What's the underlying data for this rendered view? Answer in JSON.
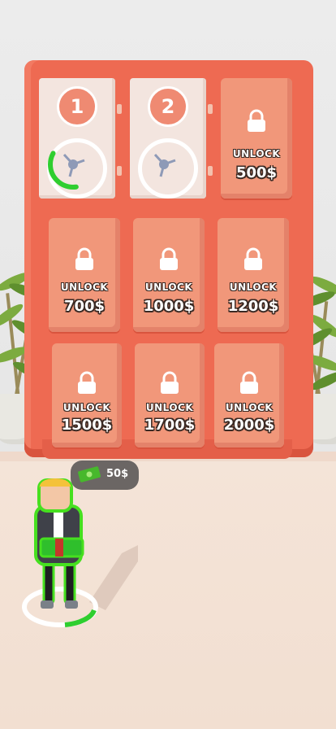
{
  "doors": [
    {
      "id": "door-1",
      "state": "open",
      "number": "1",
      "progress": 0.35
    },
    {
      "id": "door-2",
      "state": "open",
      "number": "2",
      "progress": 0
    },
    {
      "id": "door-3",
      "state": "locked",
      "label": "UNLOCK",
      "price": "500$"
    },
    {
      "id": "door-4",
      "state": "locked",
      "label": "UNLOCK",
      "price": "700$"
    },
    {
      "id": "door-5",
      "state": "locked",
      "label": "UNLOCK",
      "price": "1000$"
    },
    {
      "id": "door-6",
      "state": "locked",
      "label": "UNLOCK",
      "price": "1200$"
    },
    {
      "id": "door-7",
      "state": "locked",
      "label": "UNLOCK",
      "price": "1500$"
    },
    {
      "id": "door-8",
      "state": "locked",
      "label": "UNLOCK",
      "price": "1700$"
    },
    {
      "id": "door-9",
      "state": "locked",
      "label": "UNLOCK",
      "price": "2000$"
    }
  ],
  "player": {
    "money": "50$",
    "unlock_progress": 0.25
  },
  "colors": {
    "cabinet": "#ee6a52",
    "door": "#f1977a",
    "progress": "#2fce2f",
    "outline": "#46e01f"
  }
}
